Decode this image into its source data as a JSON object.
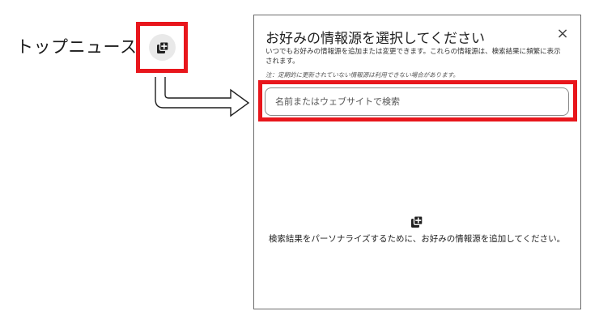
{
  "top_news": {
    "label": "トップニュース",
    "icon": "add-source-icon"
  },
  "dialog": {
    "title": "お好みの情報源を選択してください",
    "close_icon": "×",
    "description": "いつでもお好みの情報源を追加または変更できます。これらの情報源は、検索結果に頻繁に表示されます。",
    "note": "注：定期的に更新されていない情報源は利用できない場合があります。",
    "search_placeholder": "名前またはウェブサイトで検索",
    "empty_icon": "add-source-icon",
    "empty_message": "検索結果をパーソナライズするために、お好みの情報源を追加してください。"
  },
  "colors": {
    "highlight": "#e8161c",
    "icon_background": "#e9e9e9",
    "panel_border": "#6b6b6b"
  }
}
